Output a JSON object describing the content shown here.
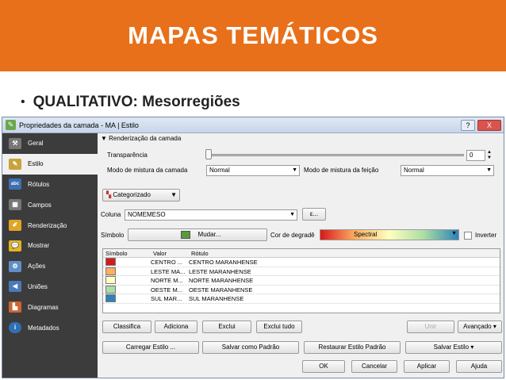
{
  "slide": {
    "title": "MAPAS TEMÁTICOS",
    "bullet": "QUALITATIVO: Mesorregiões"
  },
  "window": {
    "title": "Propriedades da camada - MA | Estilo",
    "help": "?",
    "close": "X"
  },
  "sidebar": {
    "items": [
      {
        "label": "Geral",
        "icon": "wrench-icon",
        "color": "#777777"
      },
      {
        "label": "Estilo",
        "icon": "brush-icon",
        "color": "#c9a23a"
      },
      {
        "label": "Rótulos",
        "icon": "abc-icon",
        "color": "#3d6fb3"
      },
      {
        "label": "Campos",
        "icon": "table-icon",
        "color": "#777777"
      },
      {
        "label": "Renderização",
        "icon": "paintbrush-icon",
        "color": "#e0a526"
      },
      {
        "label": "Mostrar",
        "icon": "speech-bubble-icon",
        "color": "#e0b526"
      },
      {
        "label": "Ações",
        "icon": "gear-icon",
        "color": "#5f8fc7"
      },
      {
        "label": "Uniões",
        "icon": "join-icon",
        "color": "#4a7ab8"
      },
      {
        "label": "Diagramas",
        "icon": "chart-icon",
        "color": "#cc6633"
      },
      {
        "label": "Metadados",
        "icon": "info-icon",
        "color": "#2f6fb5"
      }
    ]
  },
  "render": {
    "header": "Renderização da camada",
    "transparency_label": "Transparência",
    "transparency_value": "0",
    "blend_layer_label": "Modo de mistura da camada",
    "blend_layer_value": "Normal",
    "blend_feature_label": "Modo de mistura da feição",
    "blend_feature_value": "Normal"
  },
  "renderer": {
    "type": "Categorizado"
  },
  "column": {
    "label": "Coluna",
    "value": "NOMEMESO",
    "expr": "ε..."
  },
  "symbol": {
    "label": "Símbolo",
    "button": "Mudar...",
    "color": "#5a9a3a",
    "ramp_label": "Cor de degradê",
    "ramp_value": "Spectral",
    "invert_label": "Inverter"
  },
  "table": {
    "headers": [
      "Símbolo",
      "Valor",
      "Rótulo"
    ],
    "rows": [
      {
        "color": "#d7191c",
        "value": "CENTRO ...",
        "label": "CENTRO MARANHENSE"
      },
      {
        "color": "#fdae61",
        "value": "LESTE MA...",
        "label": "LESTE MARANHENSE"
      },
      {
        "color": "#ffffbf",
        "value": "NORTE M...",
        "label": "NORTE MARANHENSE"
      },
      {
        "color": "#abdda4",
        "value": "OESTE M...",
        "label": "OESTE MARANHENSE"
      },
      {
        "color": "#2b83ba",
        "value": "SUL MAR...",
        "label": "SUL MARANHENSE"
      }
    ]
  },
  "buttons": {
    "classify": "Classifica",
    "add": "Adiciona",
    "delete": "Exclui",
    "delete_all": "Exclui tudo",
    "join": "Unir",
    "advanced": "Avançado",
    "load_style": "Carregar Estilo ...",
    "save_default": "Salvar como Padrão",
    "restore_default": "Restaurar Estilo Padrão",
    "save_style": "Salvar Estilo",
    "ok": "OK",
    "cancel": "Cancelar",
    "apply": "Aplicar",
    "help": "Ajuda"
  }
}
